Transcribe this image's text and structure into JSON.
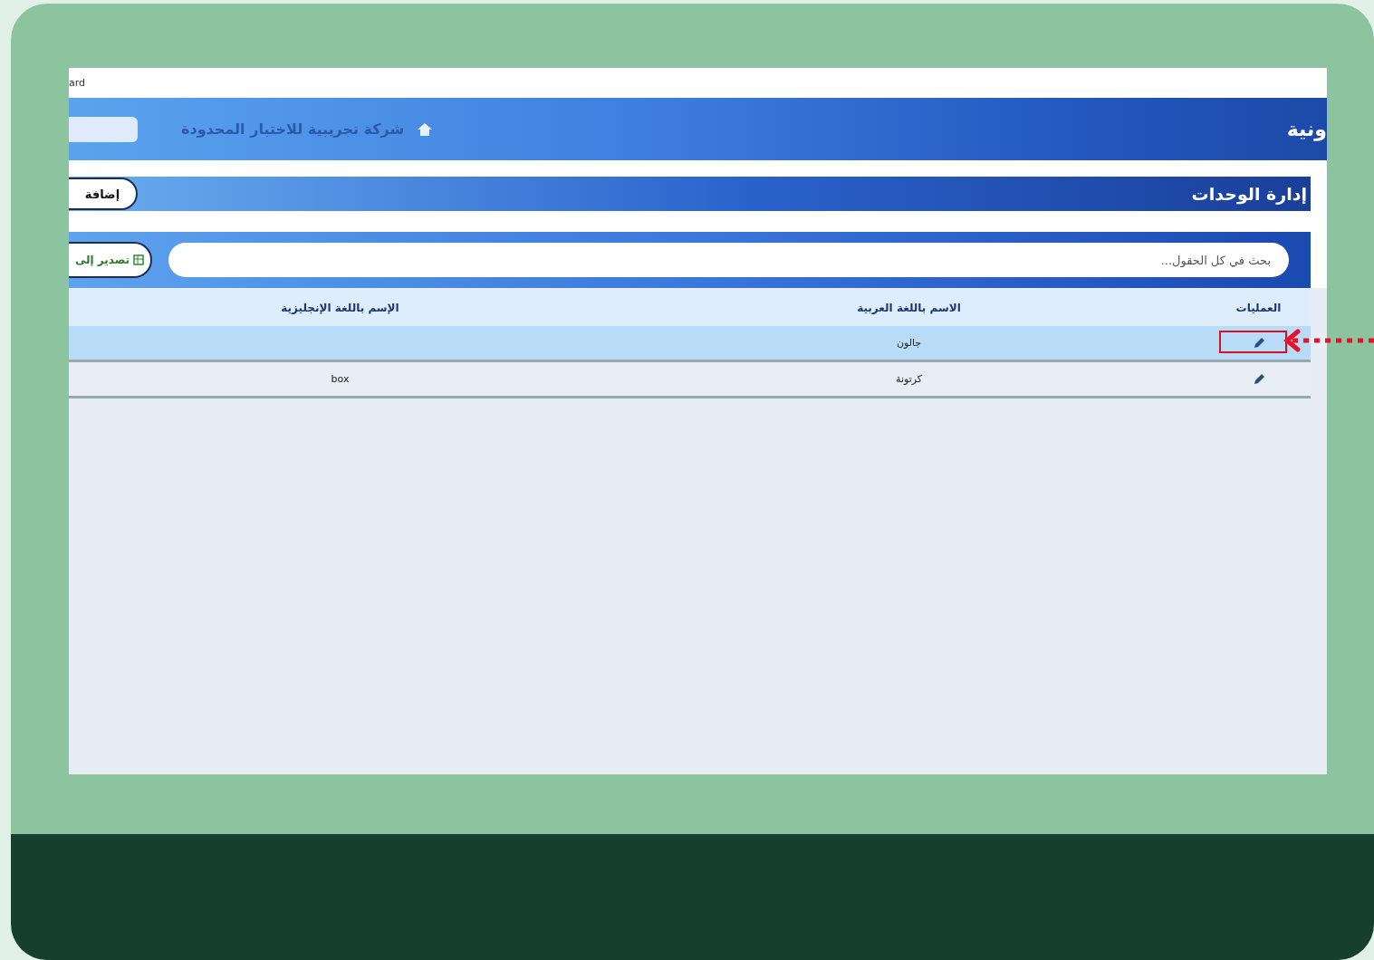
{
  "browser_strip": {
    "text": "ard"
  },
  "header": {
    "title": "ونية",
    "company": "شركة تجريبية للاختبار المحدودة"
  },
  "title_bar": {
    "title": "إدارة الوحدات",
    "add_button": "إضافة"
  },
  "toolbar": {
    "export_button": "تصدير إلى",
    "search": {
      "placeholder": "بحث في كل الحقول..."
    }
  },
  "table": {
    "columns": [
      "العمليات",
      "الاسم باللغة العربية",
      "الإسم باللغة الإنجليزية"
    ],
    "rows": [
      {
        "name_ar": "جالون",
        "name_en": "",
        "selected": true,
        "annotated": true
      },
      {
        "name_ar": "كرتونة",
        "name_en": "box",
        "selected": false,
        "annotated": false
      }
    ]
  }
}
